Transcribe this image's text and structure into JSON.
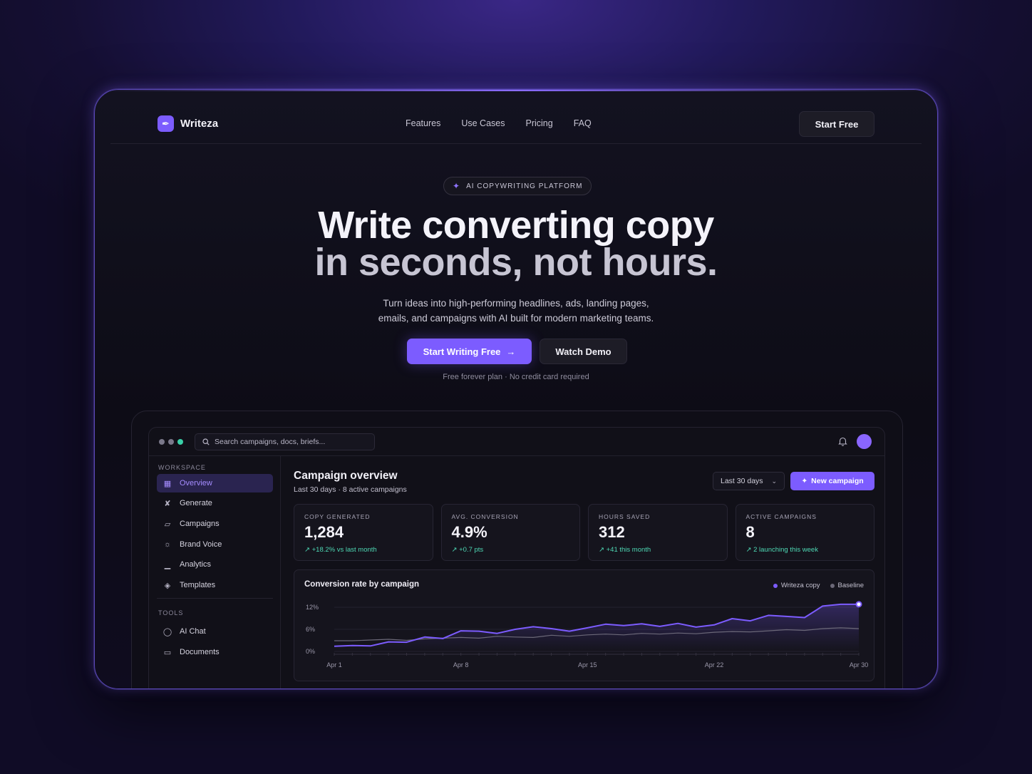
{
  "brand": {
    "name": "Writeza"
  },
  "nav": {
    "links": [
      "Features",
      "Use Cases",
      "Pricing",
      "FAQ"
    ],
    "cta": "Start Free"
  },
  "hero": {
    "badge": "AI COPYWRITING PLATFORM",
    "title_line1": "Write converting copy",
    "title_line2": "in seconds, not hours.",
    "subtitle_line1": "Turn ideas into high-performing headlines, ads, landing pages,",
    "subtitle_line2": "emails, and campaigns with AI built for modern marketing teams.",
    "primary_cta": "Start Writing Free",
    "secondary_cta": "Watch Demo",
    "note": "Free forever plan · No credit card required"
  },
  "app": {
    "search_placeholder": "Search campaigns, docs, briefs...",
    "sidebar": {
      "workspace_heading": "WORKSPACE",
      "workspace_items": [
        "Overview",
        "Generate",
        "Campaigns",
        "Brand Voice",
        "Analytics",
        "Templates"
      ],
      "tools_heading": "TOOLS",
      "tools_items": [
        "AI Chat",
        "Documents"
      ]
    },
    "main": {
      "title": "Campaign overview",
      "subtitle": "Last 30 days · 8 active campaigns",
      "range_select": "Last 30 days",
      "new_button": "New campaign",
      "stats": [
        {
          "label": "COPY GENERATED",
          "value": "1,284",
          "delta": "+18.2% vs last month"
        },
        {
          "label": "AVG. CONVERSION",
          "value": "4.9%",
          "delta": "+0.7 pts"
        },
        {
          "label": "HOURS SAVED",
          "value": "312",
          "delta": "+41 this month"
        },
        {
          "label": "ACTIVE CAMPAIGNS",
          "value": "8",
          "delta": "2 launching this week"
        }
      ]
    }
  },
  "colors": {
    "accent": "#7c5cff",
    "positive": "#4ed8b4",
    "baseline": "#6b6878"
  },
  "chart_data": {
    "type": "line",
    "title": "Conversion rate by campaign",
    "y_ticks": [
      "12%",
      "6%",
      "0%"
    ],
    "x_ticks": [
      "Apr 1",
      "Apr 8",
      "Apr 15",
      "Apr 22",
      "Apr 30"
    ],
    "x_tick_days": [
      1,
      8,
      15,
      22,
      30
    ],
    "ylim": [
      0,
      12
    ],
    "x": [
      1,
      2,
      3,
      4,
      5,
      6,
      7,
      8,
      9,
      10,
      11,
      12,
      13,
      14,
      15,
      16,
      17,
      18,
      19,
      20,
      21,
      22,
      23,
      24,
      25,
      26,
      27,
      28,
      29,
      30
    ],
    "series": [
      {
        "name": "Writeza copy",
        "color": "#7c5cff",
        "values": [
          1.4,
          1.6,
          1.5,
          2.6,
          2.5,
          3.9,
          3.5,
          5.6,
          5.5,
          4.9,
          6.0,
          6.7,
          6.2,
          5.5,
          6.4,
          7.4,
          7.0,
          7.5,
          6.8,
          7.6,
          6.6,
          7.2,
          8.9,
          8.3,
          9.8,
          9.5,
          9.2,
          12.3,
          12.8,
          12.8
        ]
      },
      {
        "name": "Baseline",
        "color": "#6b6878",
        "values": [
          2.9,
          2.9,
          3.1,
          3.3,
          3.0,
          3.4,
          3.6,
          3.8,
          3.6,
          4.1,
          3.9,
          3.8,
          4.4,
          4.1,
          4.5,
          4.7,
          4.5,
          4.9,
          4.7,
          5.0,
          4.8,
          5.2,
          5.4,
          5.3,
          5.6,
          5.9,
          5.7,
          6.2,
          6.4,
          6.2
        ]
      }
    ]
  }
}
